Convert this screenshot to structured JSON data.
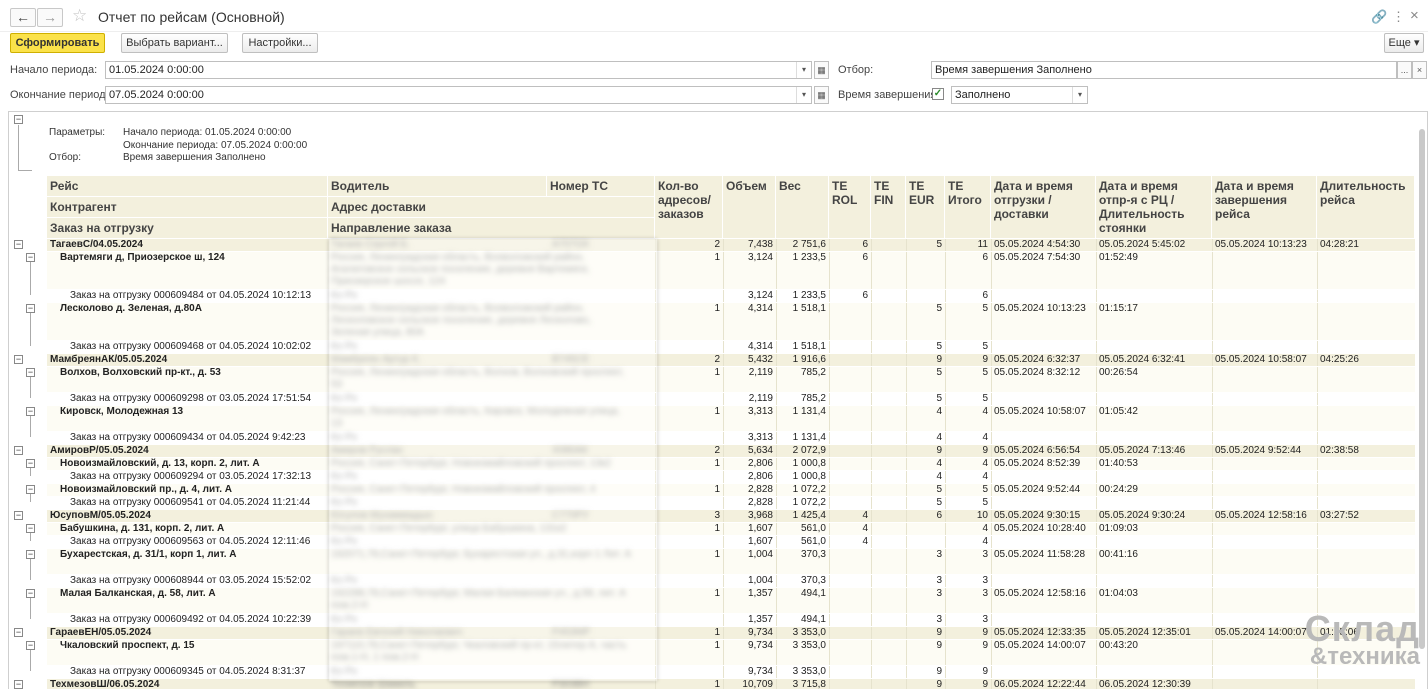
{
  "window": {
    "title": "Отчет по рейсам (Основной)",
    "back": "←",
    "forward": "→",
    "star": "☆",
    "link_icon": "🔗",
    "menu_icon": "⋮",
    "close_icon": "×"
  },
  "toolbar": {
    "generate": "Сформировать",
    "choose_variant": "Выбрать вариант...",
    "settings": "Настройки...",
    "more": "Еще ▾"
  },
  "filters": {
    "start_label": "Начало периода:",
    "start_value": "01.05.2024  0:00:00",
    "end_label": "Окончание периода:",
    "end_value": "07.05.2024  0:00:00",
    "filter_label": "Отбор:",
    "filter_value": "Время завершения Заполнено",
    "endtime_label": "Время завершения:",
    "endtime_value": "Заполнено",
    "endtime_checked": true,
    "dd": "▾",
    "cal": "▦",
    "ellipsis": "...",
    "x": "×",
    "check": "✓"
  },
  "params": {
    "label": "Параметры:",
    "start": "Начало периода: 01.05.2024 0:00:00",
    "end": "Окончание периода: 07.05.2024 0:00:00",
    "filter_label": "Отбор:",
    "filter": "Время завершения Заполнено"
  },
  "headers": {
    "reis": "Рейс",
    "driver": "Водитель",
    "vehicle": "Номер ТС",
    "counterparty": "Контрагент",
    "address": "Адрес доставки",
    "order": "Заказ на отгрузку",
    "direction": "Направление заказа",
    "count": "Кол-во адресов/ заказов",
    "volume": "Объем",
    "weight": "Вес",
    "te_rol": "TE ROL",
    "te_fin": "TE FIN",
    "te_eur": "TE EUR",
    "te_total": "TE Итого",
    "dt_ship": "Дата и время отгрузки / доставки",
    "dt_rc": "Дата и время отпр-я с РЦ / Длительность стоянки",
    "dt_end": "Дата и время завершения рейса",
    "duration": "Длительность рейса"
  },
  "tree_glyph": "−",
  "rows": [
    {
      "t": "group",
      "h": 12,
      "label": "ТагаевС/04.05.2024",
      "blur": "Тагаев Сергей Б.",
      "vehicle": "А707ОХ",
      "count": "2",
      "volume": "7,438",
      "weight": "2 751,6",
      "rol": "6",
      "fin": "",
      "eur": "5",
      "total": "11",
      "dt1": "05.05.2024 4:54:30",
      "dt2": "05.05.2024 5:45:02",
      "dt3": "05.05.2024 10:13:23",
      "dur": "04:28:21"
    },
    {
      "t": "sub",
      "h": 37,
      "label": "Вартемяги д, Приозерское ш, 124",
      "blur": "Россия, Ленинградская область, Всеволожский район, Агалатовское сельское поселение, деревня Вартемяги, Приозерское шоссе, 124",
      "count": "1",
      "volume": "3,124",
      "weight": "1 233,5",
      "rol": "6",
      "fin": "",
      "eur": "",
      "total": "6",
      "dt1": "05.05.2024 7:54:30",
      "dt2": "01:52:49",
      "dt3": "",
      "dur": ""
    },
    {
      "t": "order",
      "h": 12,
      "label": "Заказ на отгрузку 000609484 от 04.05.2024 10:12:13",
      "blur": "Ко Ро",
      "count": "",
      "volume": "3,124",
      "weight": "1 233,5",
      "rol": "6",
      "fin": "",
      "eur": "",
      "total": "6",
      "dt1": "",
      "dt2": "",
      "dt3": "",
      "dur": ""
    },
    {
      "t": "sub",
      "h": 37,
      "label": "Лесколово д. Зеленая, д.80А",
      "blur": "Россия, Ленинградская область, Всеволожский район, Лесколовское сельское поселение, деревня Лесколово, Зеленая улица, 80А",
      "count": "1",
      "volume": "4,314",
      "weight": "1 518,1",
      "rol": "",
      "fin": "",
      "eur": "5",
      "total": "5",
      "dt1": "05.05.2024 10:13:23",
      "dt2": "01:15:17",
      "dt3": "",
      "dur": ""
    },
    {
      "t": "order",
      "h": 12,
      "label": "Заказ на отгрузку 000609468 от 04.05.2024 10:02:02",
      "blur": "Ко Ро",
      "count": "",
      "volume": "4,314",
      "weight": "1 518,1",
      "rol": "",
      "fin": "",
      "eur": "5",
      "total": "5",
      "dt1": "",
      "dt2": "",
      "dt3": "",
      "dur": ""
    },
    {
      "t": "group",
      "h": 12,
      "label": "МамбреянАК/05.05.2024",
      "blur": "Мамбреян Артур К.",
      "vehicle": "В745СЕ",
      "count": "2",
      "volume": "5,432",
      "weight": "1 916,6",
      "rol": "",
      "fin": "",
      "eur": "9",
      "total": "9",
      "dt1": "05.05.2024 6:32:37",
      "dt2": "05.05.2024 6:32:41",
      "dt3": "05.05.2024 10:58:07",
      "dur": "04:25:26"
    },
    {
      "t": "sub",
      "h": 25,
      "label": "Волхов, Волховский пр-кт., д. 53",
      "blur": "Россия, Ленинградская область, Волхов, Волховский проспект, 53",
      "count": "1",
      "volume": "2,119",
      "weight": "785,2",
      "rol": "",
      "fin": "",
      "eur": "5",
      "total": "5",
      "dt1": "05.05.2024 8:32:12",
      "dt2": "00:26:54",
      "dt3": "",
      "dur": ""
    },
    {
      "t": "order",
      "h": 12,
      "label": "Заказ на отгрузку 000609298 от 03.05.2024 17:51:54",
      "blur": "Ко Ро",
      "count": "",
      "volume": "2,119",
      "weight": "785,2",
      "rol": "",
      "fin": "",
      "eur": "5",
      "total": "5",
      "dt1": "",
      "dt2": "",
      "dt3": "",
      "dur": ""
    },
    {
      "t": "sub",
      "h": 25,
      "label": "Кировск, Молодежная 13",
      "blur": "Россия, Ленинградская область, Кировск, Молодежная улица, 13",
      "count": "1",
      "volume": "3,313",
      "weight": "1 131,4",
      "rol": "",
      "fin": "",
      "eur": "4",
      "total": "4",
      "dt1": "05.05.2024 10:58:07",
      "dt2": "01:05:42",
      "dt3": "",
      "dur": ""
    },
    {
      "t": "order",
      "h": 12,
      "label": "Заказ на отгрузку 000609434 от 04.05.2024 9:42:23",
      "blur": "Ко Ро",
      "count": "",
      "volume": "3,313",
      "weight": "1 131,4",
      "rol": "",
      "fin": "",
      "eur": "4",
      "total": "4",
      "dt1": "",
      "dt2": "",
      "dt3": "",
      "dur": ""
    },
    {
      "t": "group",
      "h": 12,
      "label": "АмировР/05.05.2024",
      "blur": "Амиров Руслан",
      "vehicle": "Х080АК",
      "count": "2",
      "volume": "5,634",
      "weight": "2 072,9",
      "rol": "",
      "fin": "",
      "eur": "9",
      "total": "9",
      "dt1": "05.05.2024 6:56:54",
      "dt2": "05.05.2024 7:13:46",
      "dt3": "05.05.2024 9:52:44",
      "dur": "02:38:58"
    },
    {
      "t": "sub",
      "h": 12,
      "label": "Новоизмайловский, д. 13, корп. 2, лит. А",
      "blur": "Россия, Санкт-Петербург, Новоизмайловский проспект, 13к2",
      "count": "1",
      "volume": "2,806",
      "weight": "1 000,8",
      "rol": "",
      "fin": "",
      "eur": "4",
      "total": "4",
      "dt1": "05.05.2024 8:52:39",
      "dt2": "01:40:53",
      "dt3": "",
      "dur": ""
    },
    {
      "t": "order",
      "h": 12,
      "label": "Заказ на отгрузку 000609294 от 03.05.2024 17:32:13",
      "blur": "Ко Ро",
      "count": "",
      "volume": "2,806",
      "weight": "1 000,8",
      "rol": "",
      "fin": "",
      "eur": "4",
      "total": "4",
      "dt1": "",
      "dt2": "",
      "dt3": "",
      "dur": ""
    },
    {
      "t": "sub",
      "h": 12,
      "label": "Новоизмайловский пр., д. 4, лит. А",
      "blur": "Россия, Санкт-Петербург, Новоизмайловский проспект, 4",
      "count": "1",
      "volume": "2,828",
      "weight": "1 072,2",
      "rol": "",
      "fin": "",
      "eur": "5",
      "total": "5",
      "dt1": "05.05.2024 9:52:44",
      "dt2": "00:24:29",
      "dt3": "",
      "dur": ""
    },
    {
      "t": "order",
      "h": 12,
      "label": "Заказ на отгрузку 000609541 от 04.05.2024 11:21:44",
      "blur": "Ко Ро",
      "count": "",
      "volume": "2,828",
      "weight": "1 072,2",
      "rol": "",
      "fin": "",
      "eur": "5",
      "total": "5",
      "dt1": "",
      "dt2": "",
      "dt3": "",
      "dur": ""
    },
    {
      "t": "group",
      "h": 12,
      "label": "ЮсуповМ/05.05.2024",
      "blur": "Юсупов Мухаммадшо",
      "vehicle": "С770РУ",
      "count": "3",
      "volume": "3,968",
      "weight": "1 425,4",
      "rol": "4",
      "fin": "",
      "eur": "6",
      "total": "10",
      "dt1": "05.05.2024 9:30:15",
      "dt2": "05.05.2024 9:30:24",
      "dt3": "05.05.2024 12:58:16",
      "dur": "03:27:52"
    },
    {
      "t": "sub",
      "h": 12,
      "label": "Бабушкина, д. 131, корп. 2, лит. А",
      "blur": "Россия, Санкт-Петербург, улица Бабушкина, 131к2",
      "count": "1",
      "volume": "1,607",
      "weight": "561,0",
      "rol": "4",
      "fin": "",
      "eur": "",
      "total": "4",
      "dt1": "05.05.2024 10:28:40",
      "dt2": "01:09:03",
      "dt3": "",
      "dur": ""
    },
    {
      "t": "order",
      "h": 12,
      "label": "Заказ на отгрузку 000609563 от 04.05.2024 12:11:46",
      "blur": "Ко Ро",
      "count": "",
      "volume": "1,607",
      "weight": "561,0",
      "rol": "4",
      "fin": "",
      "eur": "",
      "total": "4",
      "dt1": "",
      "dt2": "",
      "dt3": "",
      "dur": ""
    },
    {
      "t": "sub",
      "h": 25,
      "label": "Бухарестская, д. 31/1, корп 1, лит. А",
      "blur": "192071,78,Санкт-Петербург, Бухарестская ул., д.31,корп 1 Лит. А",
      "count": "1",
      "volume": "1,004",
      "weight": "370,3",
      "rol": "",
      "fin": "",
      "eur": "3",
      "total": "3",
      "dt1": "05.05.2024 11:58:28",
      "dt2": "00:41:16",
      "dt3": "",
      "dur": ""
    },
    {
      "t": "order",
      "h": 12,
      "label": "Заказ на отгрузку 000608944 от 03.05.2024 15:52:02",
      "blur": "Ко Ро",
      "count": "",
      "volume": "1,004",
      "weight": "370,3",
      "rol": "",
      "fin": "",
      "eur": "3",
      "total": "3",
      "dt1": "",
      "dt2": "",
      "dt3": "",
      "dur": ""
    },
    {
      "t": "sub",
      "h": 25,
      "label": "Малая Балканская, д. 58, лит. А",
      "blur": "192288,78,Санкт-Петербург, Малая Балканская ул., д.58, лит. А пом.2-Н",
      "count": "1",
      "volume": "1,357",
      "weight": "494,1",
      "rol": "",
      "fin": "",
      "eur": "3",
      "total": "3",
      "dt1": "05.05.2024 12:58:16",
      "dt2": "01:04:03",
      "dt3": "",
      "dur": ""
    },
    {
      "t": "order",
      "h": 12,
      "label": "Заказ на отгрузку 000609492 от 04.05.2024 10:22:39",
      "blur": "Ко Ро",
      "count": "",
      "volume": "1,357",
      "weight": "494,1",
      "rol": "",
      "fin": "",
      "eur": "3",
      "total": "3",
      "dt1": "",
      "dt2": "",
      "dt3": "",
      "dur": ""
    },
    {
      "t": "group",
      "h": 12,
      "label": "ГараевЕН/05.05.2024",
      "blur": "Гараев Евгений Николаевич",
      "vehicle": "Р453МР",
      "count": "1",
      "volume": "9,734",
      "weight": "3 353,0",
      "rol": "",
      "fin": "",
      "eur": "9",
      "total": "9",
      "dt1": "05.05.2024 12:33:35",
      "dt2": "05.05.2024 12:35:01",
      "dt3": "05.05.2024 14:00:07",
      "dur": "01:25:06"
    },
    {
      "t": "sub",
      "h": 25,
      "label": "Чкаловский проспект, д. 15",
      "blur": "197110,78,Санкт-Петербург, Чкаловский пр-кт, 15литер А, часть пом.1-Н, 1 пом.2-Н",
      "count": "1",
      "volume": "9,734",
      "weight": "3 353,0",
      "rol": "",
      "fin": "",
      "eur": "9",
      "total": "9",
      "dt1": "05.05.2024 14:00:07",
      "dt2": "00:43:20",
      "dt3": "",
      "dur": ""
    },
    {
      "t": "order",
      "h": 12,
      "label": "Заказ на отгрузку 000609345 от 04.05.2024 8:31:37",
      "blur": "Ко Ро",
      "count": "",
      "volume": "9,734",
      "weight": "3 353,0",
      "rol": "",
      "fin": "",
      "eur": "9",
      "total": "9",
      "dt1": "",
      "dt2": "",
      "dt3": "",
      "dur": ""
    },
    {
      "t": "group",
      "h": 12,
      "label": "ТехмезовШ/06.05.2024",
      "blur": "Техмезов Шамиль",
      "vehicle": "Р303ВН",
      "count": "1",
      "volume": "10,709",
      "weight": "3 715,8",
      "rol": "",
      "fin": "",
      "eur": "9",
      "total": "9",
      "dt1": "06.05.2024 12:22:44",
      "dt2": "06.05.2024 12:30:39",
      "dt3": "",
      "dur": ""
    }
  ],
  "watermark": {
    "line1": "Склад",
    "line2": "&техника"
  },
  "colors": {
    "accent": "#fbe24a",
    "header_bg": "#f3f0dd"
  }
}
